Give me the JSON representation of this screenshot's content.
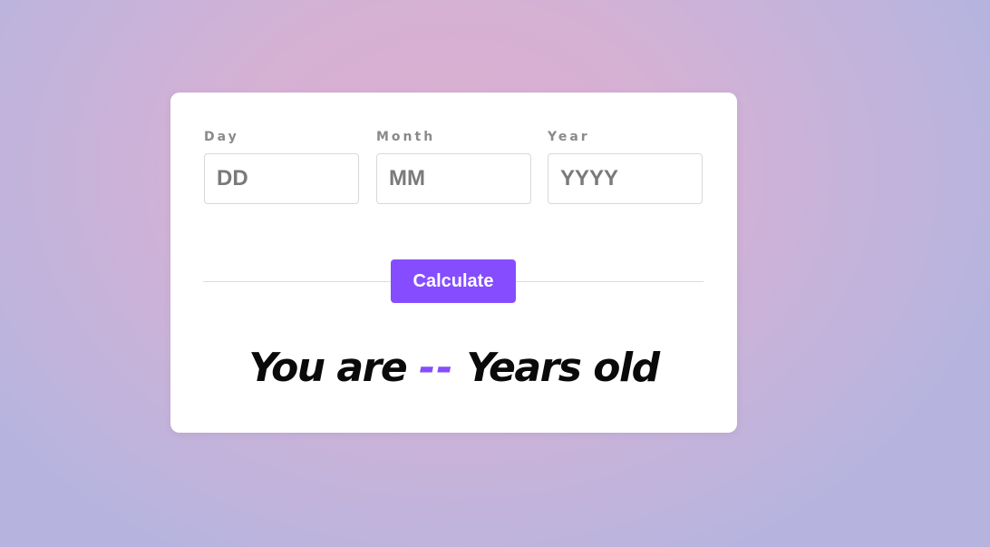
{
  "form": {
    "day": {
      "label": "Day",
      "placeholder": "DD",
      "value": ""
    },
    "month": {
      "label": "Month",
      "placeholder": "MM",
      "value": ""
    },
    "year": {
      "label": "Year",
      "placeholder": "YYYY",
      "value": ""
    },
    "calculate_label": "Calculate"
  },
  "result": {
    "prefix": "You are",
    "age": "--",
    "suffix": "Years old"
  },
  "colors": {
    "accent": "#854dff",
    "label": "#8a8a8a",
    "text": "#0a0a0a",
    "card": "#ffffff"
  }
}
